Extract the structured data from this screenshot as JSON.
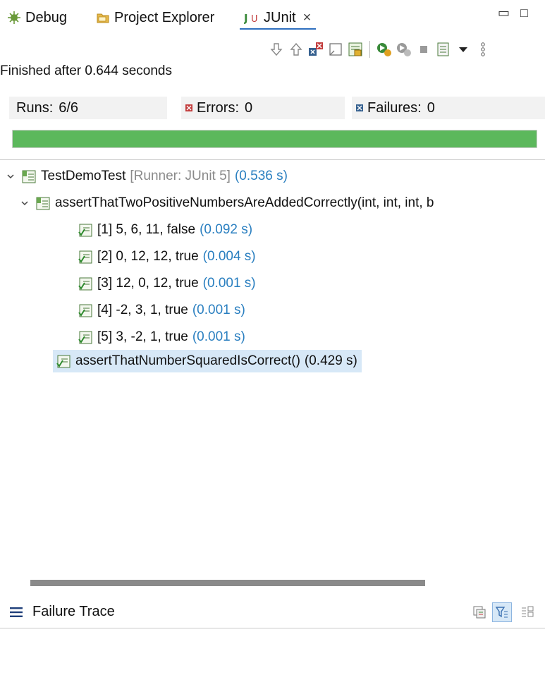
{
  "tabs": [
    {
      "label": "Debug",
      "icon": "bug-icon"
    },
    {
      "label": "Project Explorer",
      "icon": "folder-icon"
    },
    {
      "label": "JUnit",
      "icon": "junit-icon",
      "close": "×"
    }
  ],
  "window_controls": {
    "minimize": "▭",
    "maximize": "□"
  },
  "toolbar_icons": [
    "next-failure-icon",
    "previous-failure-icon",
    "show-failures-only-icon",
    "scroll-lock-icon",
    "skipped-icon",
    "rerun-icon",
    "rerun-failed-icon",
    "stop-icon",
    "history-icon",
    "view-menu-icon",
    "more-icon"
  ],
  "status": "Finished after 0.644 seconds",
  "counters": {
    "runs_label": "Runs:",
    "runs_value": "6/6",
    "errors_label": "Errors:",
    "errors_value": "0",
    "failures_label": "Failures:",
    "failures_value": "0"
  },
  "progress": {
    "fraction": 1.0,
    "color": "#5cb85c"
  },
  "tree": {
    "root": {
      "name": "TestDemoTest",
      "runner": "[Runner: JUnit 5]",
      "time": "(0.536 s)"
    },
    "group": {
      "name": "assertThatTwoPositiveNumbersAreAddedCorrectly(int, int, int, b"
    },
    "cases": [
      {
        "name": "[1] 5, 6, 11, false",
        "time": "(0.092 s)"
      },
      {
        "name": "[2] 0, 12, 12, true",
        "time": "(0.004 s)"
      },
      {
        "name": "[3] 12, 0, 12, true",
        "time": "(0.001 s)"
      },
      {
        "name": "[4] -2, 3, 1, true",
        "time": "(0.001 s)"
      },
      {
        "name": "[5] 3, -2, 1, true",
        "time": "(0.001 s)"
      }
    ],
    "selected": {
      "name": "assertThatNumberSquaredIsCorrect()",
      "time": "(0.429 s)"
    }
  },
  "failure_trace": {
    "title": "Failure Trace"
  }
}
